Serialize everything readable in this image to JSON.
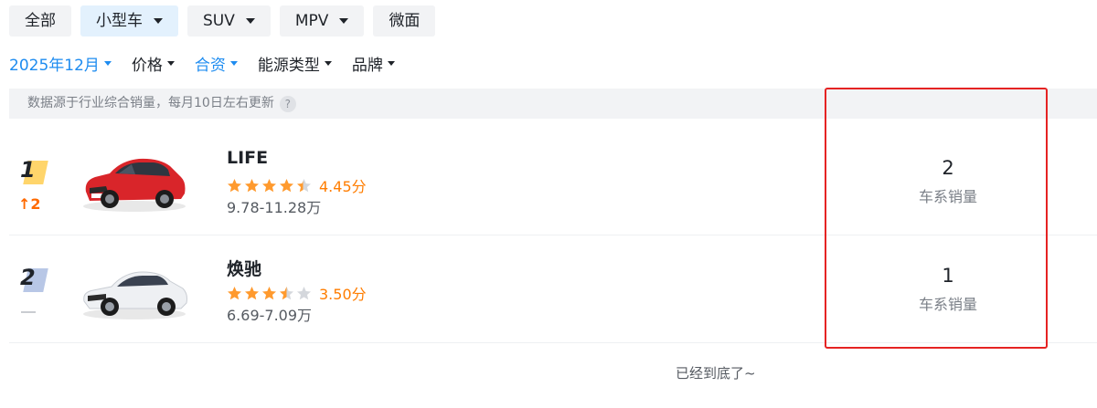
{
  "chips": {
    "all": "全部",
    "small_car": "小型车",
    "suv": "SUV",
    "mpv": "MPV",
    "micro": "微面"
  },
  "filters": {
    "month": "2025年12月",
    "price": "价格",
    "joint": "合资",
    "energy": "能源类型",
    "brand": "品牌"
  },
  "info": {
    "text": "数据源于行业综合销量，每月10日左右更新",
    "help": "?"
  },
  "rows": [
    {
      "rank": "1",
      "change": "2",
      "change_dir": "up",
      "name": "LIFE",
      "rating": 4.45,
      "score": "4.45分",
      "price": "9.78-11.28万",
      "sales": "2",
      "sales_label": "车系销量",
      "car_color": "#d9252a"
    },
    {
      "rank": "2",
      "change": "",
      "change_dir": "flat",
      "name": "焕驰",
      "rating": 3.5,
      "score": "3.50分",
      "price": "6.69-7.09万",
      "sales": "1",
      "sales_label": "车系销量",
      "car_color": "#f4f5f7"
    }
  ],
  "footer": "已经到底了~",
  "colors": {
    "accent": "#1e8cf0",
    "star": "#ff9a2e",
    "score": "#ff7d00",
    "rank_up": "#ff6a00",
    "highlight": "#e52323"
  }
}
